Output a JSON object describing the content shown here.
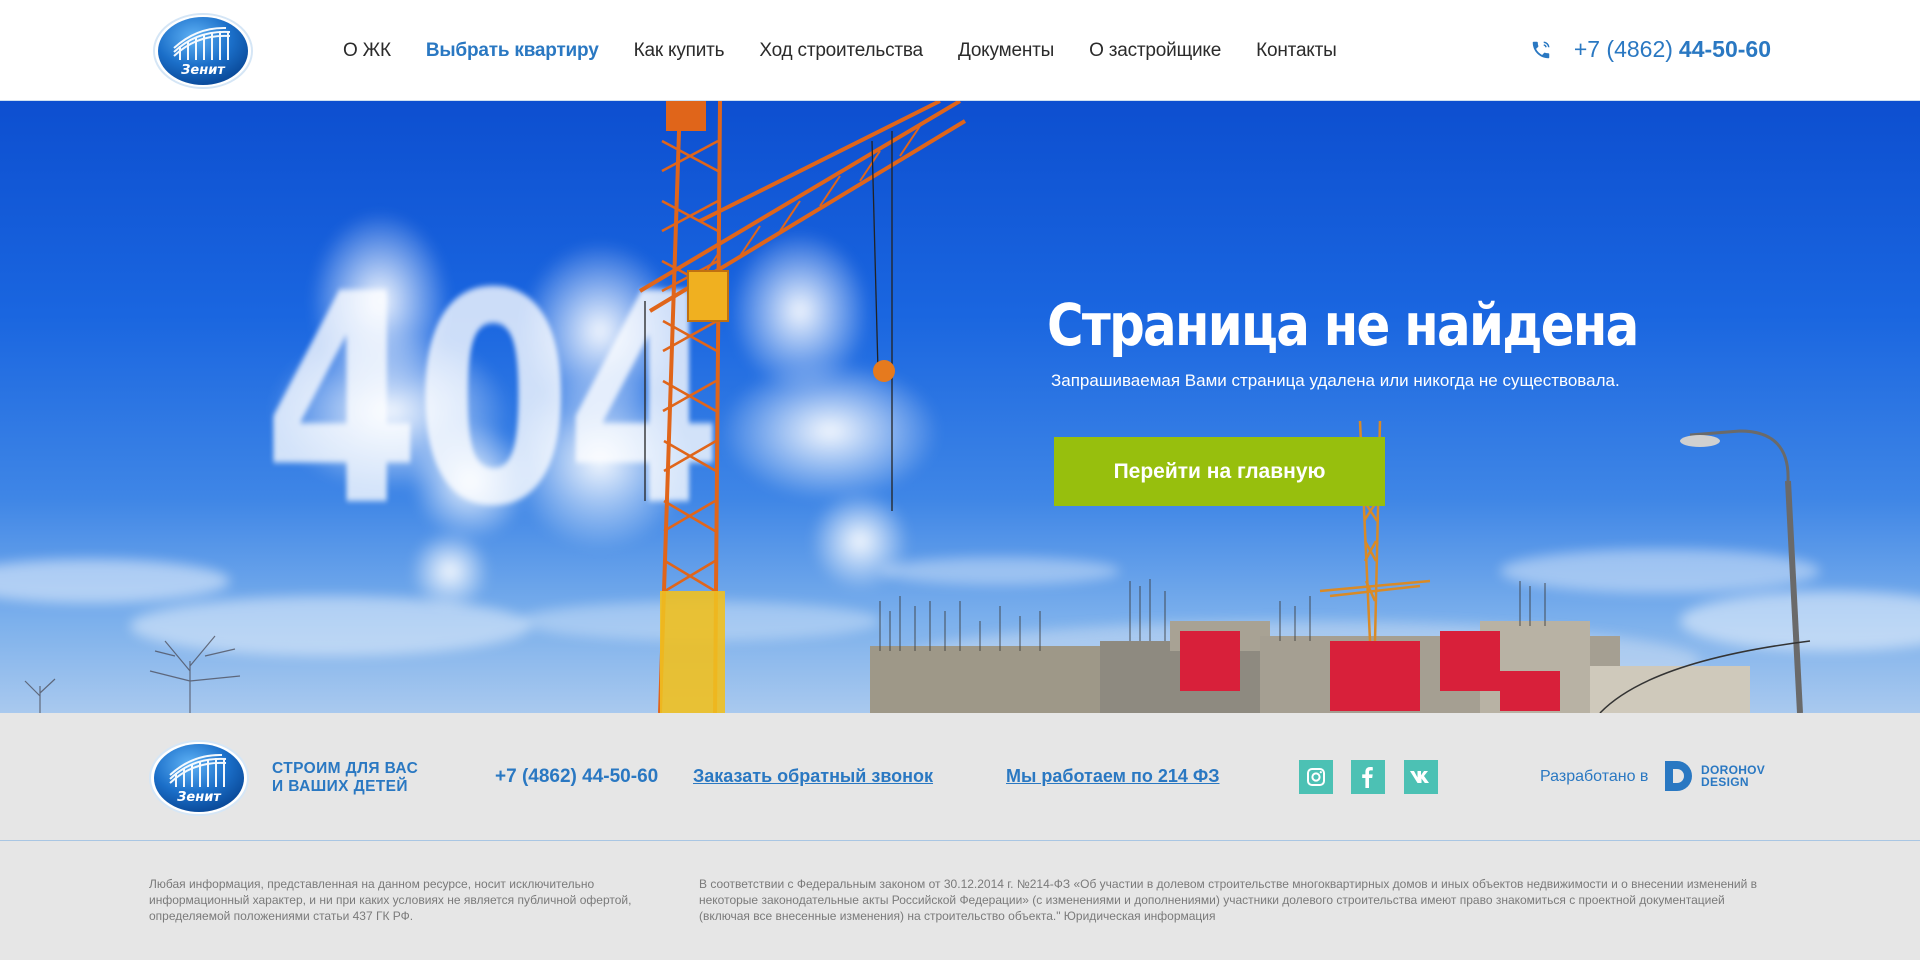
{
  "header": {
    "logo_text": "Зенит",
    "nav": [
      {
        "label": "О ЖК",
        "active": false
      },
      {
        "label": "Выбрать квартиру",
        "active": true
      },
      {
        "label": "Как купить",
        "active": false
      },
      {
        "label": "Ход строительства",
        "active": false
      },
      {
        "label": "Документы",
        "active": false
      },
      {
        "label": "О застройщике",
        "active": false
      },
      {
        "label": "Контакты",
        "active": false
      }
    ],
    "phone_prefix": "+7 (4862)",
    "phone_main": "44-50-60"
  },
  "hero": {
    "error_code": "404",
    "title": "Страница не найдена",
    "subtitle": "Запрашиваемая Вами страница удалена или никогда не существовала.",
    "cta_label": "Перейти на главную"
  },
  "footer": {
    "logo_text": "Зенит",
    "slogan_line1": "СТРОИМ ДЛЯ ВАС",
    "slogan_line2": "И ВАШИХ ДЕТЕЙ",
    "phone": "+7 (4862) 44-50-60",
    "callback_link": "Заказать обратный звонок",
    "law_link": "Мы работаем по 214 ФЗ",
    "social": [
      "instagram-icon",
      "facebook-icon",
      "vk-icon"
    ],
    "developed_by": "Разработано в",
    "developer_line1": "DOROHOV",
    "developer_line2": "DESIGN",
    "legal_left": "Любая информация, представленная на данном ресурсе, носит исключительно информационный характер, и ни при каких условиях не является публичной офертой, определяемой положениями статьи 437 ГК РФ.",
    "legal_right": "В соответствии с Федеральным законом от 30.12.2014 г. №214-ФЗ «Об участии в долевом строительстве многоквартирных домов и иных объектов недвижимости и о внесении изменений в некоторые законодательные акты Российской Федерации» (с изменениями и дополнениями) участники долевого строительства имеют право знакомиться с проектной документацией (включая все внесенные изменения) на строительство объекта.\" Юридическая информация"
  },
  "colors": {
    "brand_blue": "#2a78c2",
    "cta_green": "#97bf0d",
    "social_teal": "#4cc1b4",
    "footer_bg": "#e6e6e6"
  }
}
